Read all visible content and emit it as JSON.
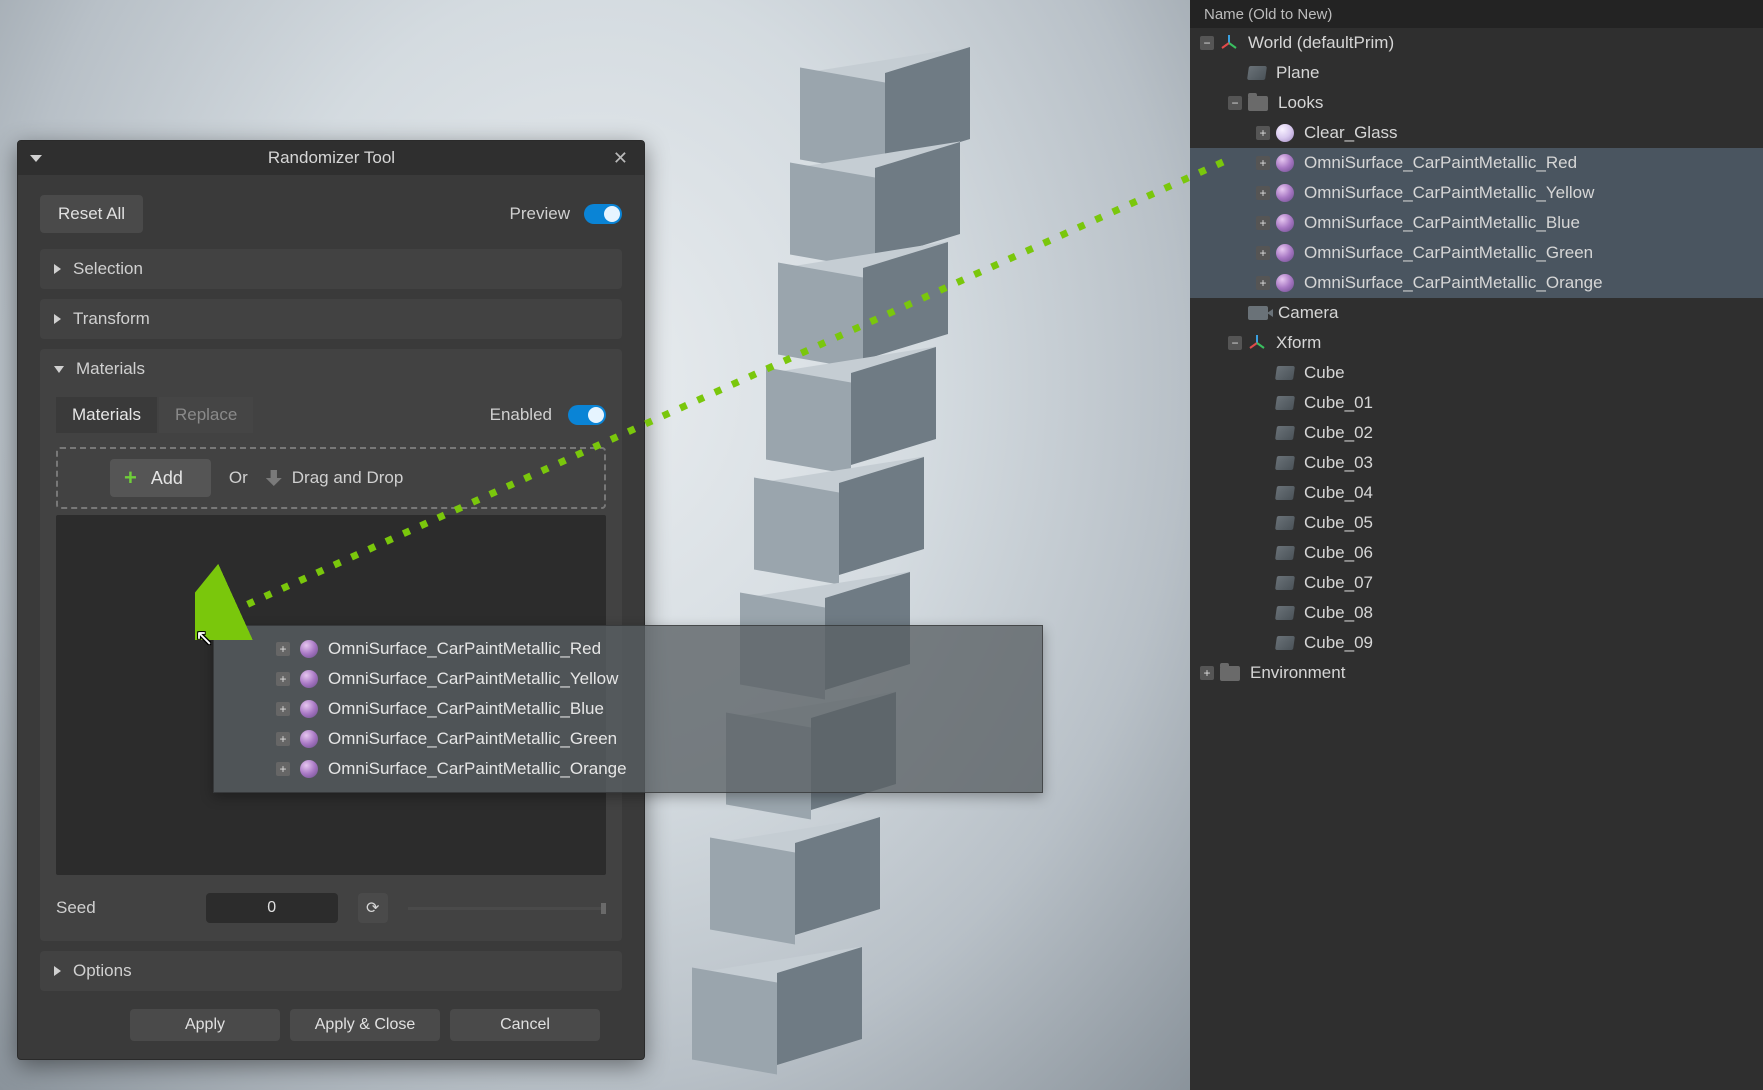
{
  "tool_panel": {
    "title": "Randomizer Tool",
    "reset_all": "Reset All",
    "preview_label": "Preview",
    "selection_label": "Selection",
    "transform_label": "Transform",
    "materials_label": "Materials",
    "tab_materials": "Materials",
    "tab_replace": "Replace",
    "enabled_label": "Enabled",
    "add_label": "Add",
    "or_label": "Or",
    "dnd_label": "Drag and Drop",
    "seed_label": "Seed",
    "seed_value": "0",
    "options_label": "Options",
    "apply": "Apply",
    "apply_close": "Apply & Close",
    "cancel": "Cancel"
  },
  "drag_tooltip": {
    "items": [
      "OmniSurface_CarPaintMetallic_Red",
      "OmniSurface_CarPaintMetallic_Yellow",
      "OmniSurface_CarPaintMetallic_Blue",
      "OmniSurface_CarPaintMetallic_Green",
      "OmniSurface_CarPaintMetallic_Orange"
    ]
  },
  "outliner": {
    "header": "Name (Old to New)",
    "world": "World (defaultPrim)",
    "plane": "Plane",
    "looks": "Looks",
    "clear_glass": "Clear_Glass",
    "mats": [
      "OmniSurface_CarPaintMetallic_Red",
      "OmniSurface_CarPaintMetallic_Yellow",
      "OmniSurface_CarPaintMetallic_Blue",
      "OmniSurface_CarPaintMetallic_Green",
      "OmniSurface_CarPaintMetallic_Orange"
    ],
    "camera": "Camera",
    "xform": "Xform",
    "cubes": [
      "Cube",
      "Cube_01",
      "Cube_02",
      "Cube_03",
      "Cube_04",
      "Cube_05",
      "Cube_06",
      "Cube_07",
      "Cube_08",
      "Cube_09"
    ],
    "environment": "Environment"
  }
}
